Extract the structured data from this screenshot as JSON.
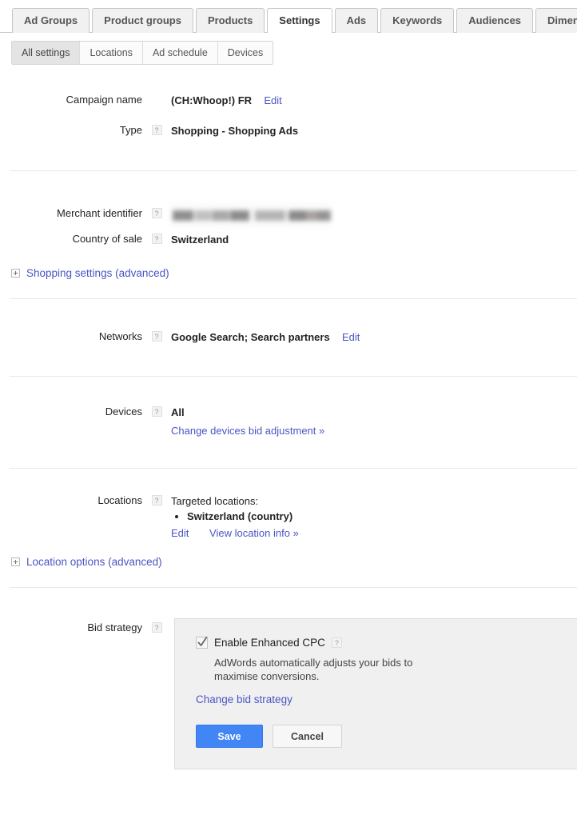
{
  "tabs": [
    {
      "label": "Ad Groups",
      "selected": false
    },
    {
      "label": "Product groups",
      "selected": false
    },
    {
      "label": "Products",
      "selected": false
    },
    {
      "label": "Settings",
      "selected": true
    },
    {
      "label": "Ads",
      "selected": false
    },
    {
      "label": "Keywords",
      "selected": false
    },
    {
      "label": "Audiences",
      "selected": false
    },
    {
      "label": "Dimensions",
      "selected": false
    }
  ],
  "subtabs": [
    {
      "label": "All settings",
      "selected": true
    },
    {
      "label": "Locations",
      "selected": false
    },
    {
      "label": "Ad schedule",
      "selected": false
    },
    {
      "label": "Devices",
      "selected": false
    }
  ],
  "help_glyph": "?",
  "settings": {
    "campaign_name": {
      "label": "Campaign name",
      "value": "(CH:Whoop!) FR",
      "edit_label": "Edit"
    },
    "type": {
      "label": "Type",
      "value": "Shopping - Shopping Ads"
    },
    "merchant_identifier": {
      "label": "Merchant identifier",
      "value": ""
    },
    "country_of_sale": {
      "label": "Country of sale",
      "value": "Switzerland"
    },
    "shopping_settings_advanced": {
      "label": "Shopping settings (advanced)"
    },
    "networks": {
      "label": "Networks",
      "value": "Google Search; Search partners",
      "edit_label": "Edit"
    },
    "devices": {
      "label": "Devices",
      "value": "All",
      "change_link": "Change devices bid adjustment »"
    },
    "locations": {
      "label": "Locations",
      "heading": "Targeted locations:",
      "targets": [
        "Switzerland (country)"
      ],
      "edit_label": "Edit",
      "view_info_label": "View location info »"
    },
    "location_options_advanced": {
      "label": "Location options (advanced)"
    },
    "bid_strategy": {
      "label": "Bid strategy",
      "checkbox_label": "Enable Enhanced CPC",
      "checkbox_checked": true,
      "description": "AdWords automatically adjusts your bids to maximise conversions.",
      "change_link": "Change bid strategy",
      "save_label": "Save",
      "cancel_label": "Cancel"
    }
  },
  "colors": {
    "link": "#4a55c4",
    "primary_button": "#4285f4",
    "panel_bg": "#f0f0f0",
    "tab_bg": "#f1f1f1"
  }
}
